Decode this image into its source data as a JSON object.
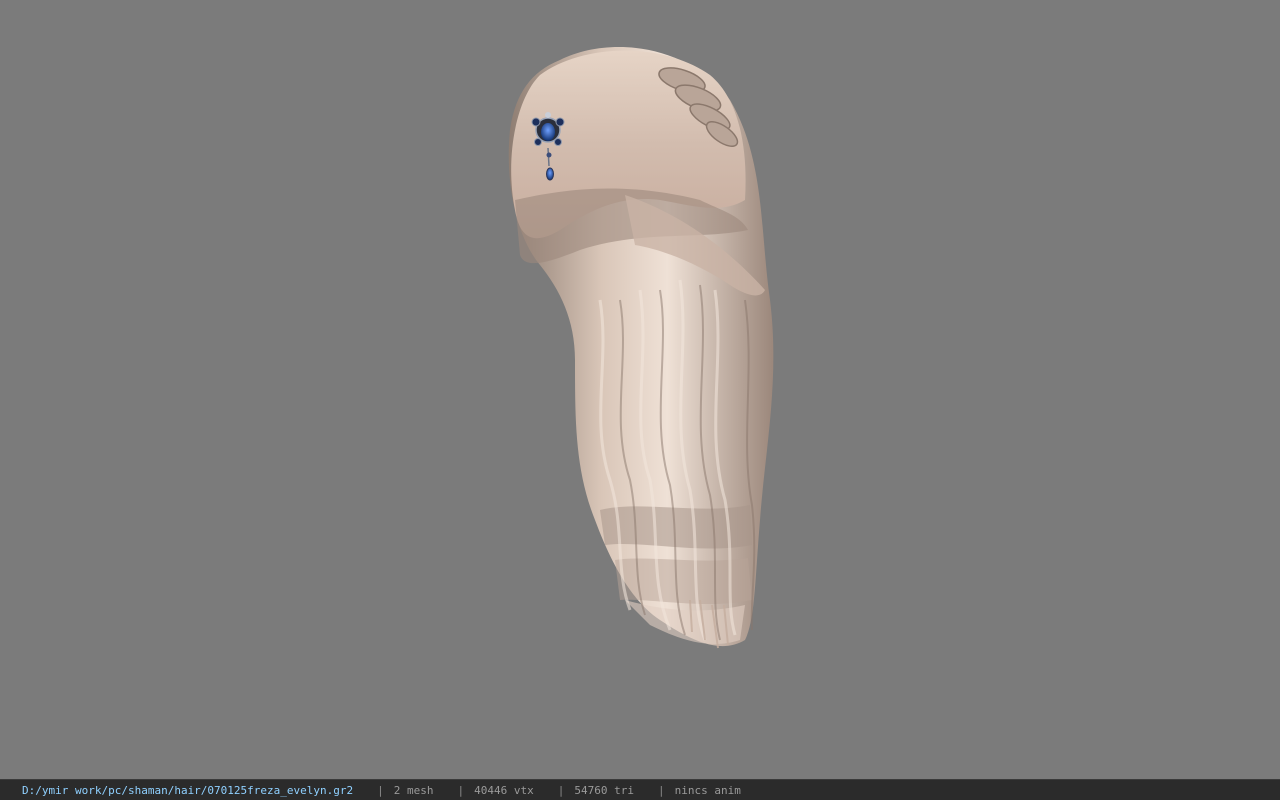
{
  "viewer": {
    "background_color": "#7b7b7b",
    "model": {
      "subject": "hair model",
      "hair_color": "#d6c0b2",
      "accessory": "blue jeweled hair pin",
      "accessory_color": "#1e4fa8"
    }
  },
  "statusbar": {
    "path": "D:/ymir work/pc/shaman/hair/070125freza_evelyn.gr2",
    "separator": "|",
    "mesh": "2 mesh",
    "vertices": "40446 vtx",
    "triangles": "54760 tri",
    "anim": "nincs anim",
    "path_color": "#8fd0ff"
  }
}
